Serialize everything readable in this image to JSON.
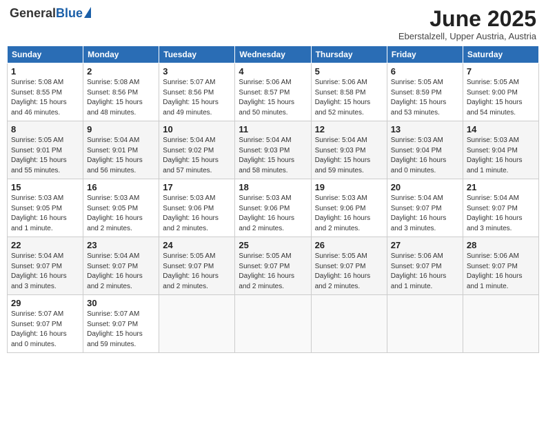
{
  "header": {
    "logo_general": "General",
    "logo_blue": "Blue",
    "month_title": "June 2025",
    "location": "Eberstalzell, Upper Austria, Austria"
  },
  "weekdays": [
    "Sunday",
    "Monday",
    "Tuesday",
    "Wednesday",
    "Thursday",
    "Friday",
    "Saturday"
  ],
  "weeks": [
    [
      {
        "day": "1",
        "sunrise": "5:08 AM",
        "sunset": "8:55 PM",
        "daylight": "15 hours and 46 minutes."
      },
      {
        "day": "2",
        "sunrise": "5:08 AM",
        "sunset": "8:56 PM",
        "daylight": "15 hours and 48 minutes."
      },
      {
        "day": "3",
        "sunrise": "5:07 AM",
        "sunset": "8:56 PM",
        "daylight": "15 hours and 49 minutes."
      },
      {
        "day": "4",
        "sunrise": "5:06 AM",
        "sunset": "8:57 PM",
        "daylight": "15 hours and 50 minutes."
      },
      {
        "day": "5",
        "sunrise": "5:06 AM",
        "sunset": "8:58 PM",
        "daylight": "15 hours and 52 minutes."
      },
      {
        "day": "6",
        "sunrise": "5:05 AM",
        "sunset": "8:59 PM",
        "daylight": "15 hours and 53 minutes."
      },
      {
        "day": "7",
        "sunrise": "5:05 AM",
        "sunset": "9:00 PM",
        "daylight": "15 hours and 54 minutes."
      }
    ],
    [
      {
        "day": "8",
        "sunrise": "5:05 AM",
        "sunset": "9:01 PM",
        "daylight": "15 hours and 55 minutes."
      },
      {
        "day": "9",
        "sunrise": "5:04 AM",
        "sunset": "9:01 PM",
        "daylight": "15 hours and 56 minutes."
      },
      {
        "day": "10",
        "sunrise": "5:04 AM",
        "sunset": "9:02 PM",
        "daylight": "15 hours and 57 minutes."
      },
      {
        "day": "11",
        "sunrise": "5:04 AM",
        "sunset": "9:03 PM",
        "daylight": "15 hours and 58 minutes."
      },
      {
        "day": "12",
        "sunrise": "5:04 AM",
        "sunset": "9:03 PM",
        "daylight": "15 hours and 59 minutes."
      },
      {
        "day": "13",
        "sunrise": "5:03 AM",
        "sunset": "9:04 PM",
        "daylight": "16 hours and 0 minutes."
      },
      {
        "day": "14",
        "sunrise": "5:03 AM",
        "sunset": "9:04 PM",
        "daylight": "16 hours and 1 minute."
      }
    ],
    [
      {
        "day": "15",
        "sunrise": "5:03 AM",
        "sunset": "9:05 PM",
        "daylight": "16 hours and 1 minute."
      },
      {
        "day": "16",
        "sunrise": "5:03 AM",
        "sunset": "9:05 PM",
        "daylight": "16 hours and 2 minutes."
      },
      {
        "day": "17",
        "sunrise": "5:03 AM",
        "sunset": "9:06 PM",
        "daylight": "16 hours and 2 minutes."
      },
      {
        "day": "18",
        "sunrise": "5:03 AM",
        "sunset": "9:06 PM",
        "daylight": "16 hours and 2 minutes."
      },
      {
        "day": "19",
        "sunrise": "5:03 AM",
        "sunset": "9:06 PM",
        "daylight": "16 hours and 2 minutes."
      },
      {
        "day": "20",
        "sunrise": "5:04 AM",
        "sunset": "9:07 PM",
        "daylight": "16 hours and 3 minutes."
      },
      {
        "day": "21",
        "sunrise": "5:04 AM",
        "sunset": "9:07 PM",
        "daylight": "16 hours and 3 minutes."
      }
    ],
    [
      {
        "day": "22",
        "sunrise": "5:04 AM",
        "sunset": "9:07 PM",
        "daylight": "16 hours and 3 minutes."
      },
      {
        "day": "23",
        "sunrise": "5:04 AM",
        "sunset": "9:07 PM",
        "daylight": "16 hours and 2 minutes."
      },
      {
        "day": "24",
        "sunrise": "5:05 AM",
        "sunset": "9:07 PM",
        "daylight": "16 hours and 2 minutes."
      },
      {
        "day": "25",
        "sunrise": "5:05 AM",
        "sunset": "9:07 PM",
        "daylight": "16 hours and 2 minutes."
      },
      {
        "day": "26",
        "sunrise": "5:05 AM",
        "sunset": "9:07 PM",
        "daylight": "16 hours and 2 minutes."
      },
      {
        "day": "27",
        "sunrise": "5:06 AM",
        "sunset": "9:07 PM",
        "daylight": "16 hours and 1 minute."
      },
      {
        "day": "28",
        "sunrise": "5:06 AM",
        "sunset": "9:07 PM",
        "daylight": "16 hours and 1 minute."
      }
    ],
    [
      {
        "day": "29",
        "sunrise": "5:07 AM",
        "sunset": "9:07 PM",
        "daylight": "16 hours and 0 minutes."
      },
      {
        "day": "30",
        "sunrise": "5:07 AM",
        "sunset": "9:07 PM",
        "daylight": "15 hours and 59 minutes."
      },
      null,
      null,
      null,
      null,
      null
    ]
  ]
}
